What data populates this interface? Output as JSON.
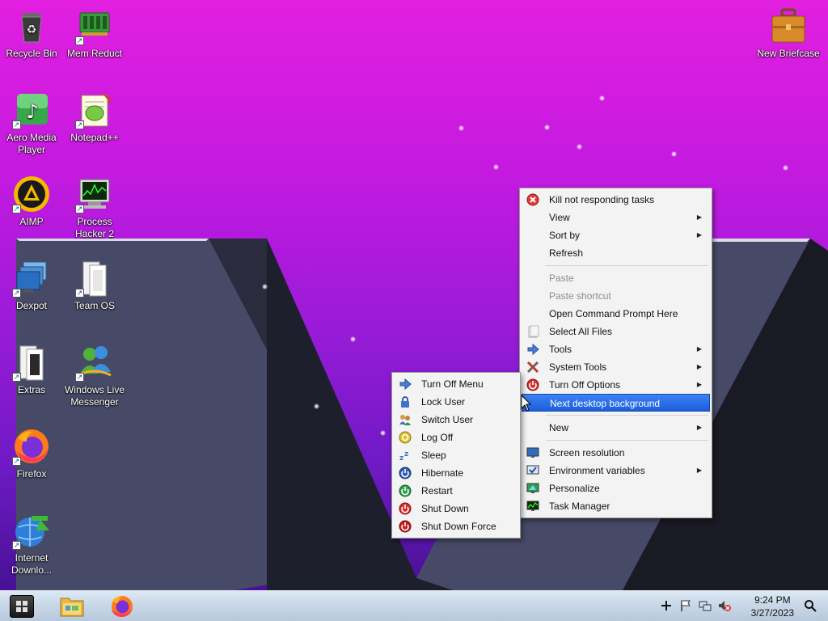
{
  "desktop": {
    "icons": [
      {
        "label": "Recycle Bin",
        "icon": "recycle-bin-icon"
      },
      {
        "label": "Mem Reduct",
        "icon": "mem-reduct-icon"
      },
      {
        "label": "Aero Media Player",
        "icon": "media-player-icon"
      },
      {
        "label": "Notepad++",
        "icon": "notepad-plus-plus-icon"
      },
      {
        "label": "AIMP",
        "icon": "aimp-icon"
      },
      {
        "label": "Process Hacker 2",
        "icon": "process-hacker-icon"
      },
      {
        "label": "Dexpot",
        "icon": "dexpot-icon"
      },
      {
        "label": "Team OS",
        "icon": "folder-icon"
      },
      {
        "label": "Extras",
        "icon": "folder-icon"
      },
      {
        "label": "Windows Live Messenger",
        "icon": "messenger-icon"
      },
      {
        "label": "Firefox",
        "icon": "firefox-icon"
      },
      {
        "label": "Internet Downlo...",
        "icon": "internet-download-manager-icon"
      },
      {
        "label": "New Briefcase",
        "icon": "briefcase-icon"
      }
    ]
  },
  "context_menu": {
    "items": [
      {
        "label": "Kill not responding tasks",
        "icon": "kill-tasks-icon"
      },
      {
        "label": "View",
        "submenu": true
      },
      {
        "label": "Sort by",
        "submenu": true
      },
      {
        "label": "Refresh"
      },
      {
        "label": "Paste",
        "disabled": true
      },
      {
        "label": "Paste shortcut",
        "disabled": true
      },
      {
        "label": "Open Command Prompt Here"
      },
      {
        "label": "Select All Files",
        "icon": "select-all-icon"
      },
      {
        "label": "Tools",
        "icon": "tools-arrow-icon",
        "submenu": true
      },
      {
        "label": "System Tools",
        "icon": "system-tools-icon",
        "submenu": true
      },
      {
        "label": "Turn Off Options",
        "icon": "power-icon",
        "submenu": true
      },
      {
        "label": "Next desktop background",
        "highlighted": true
      },
      {
        "label": "New",
        "submenu": true
      },
      {
        "label": "Screen resolution",
        "icon": "monitor-icon"
      },
      {
        "label": "Environment variables",
        "icon": "monitor-check-icon",
        "submenu": true
      },
      {
        "label": "Personalize",
        "icon": "personalize-icon"
      },
      {
        "label": "Task Manager",
        "icon": "task-manager-icon"
      }
    ]
  },
  "turn_off_submenu": {
    "items": [
      {
        "label": "Turn Off Menu",
        "icon": "arrow-right-icon"
      },
      {
        "label": "Lock User",
        "icon": "lock-icon"
      },
      {
        "label": "Switch User",
        "icon": "switch-user-icon"
      },
      {
        "label": "Log Off",
        "icon": "log-off-icon"
      },
      {
        "label": "Sleep",
        "icon": "sleep-icon"
      },
      {
        "label": "Hibernate",
        "icon": "hibernate-icon"
      },
      {
        "label": "Restart",
        "icon": "restart-icon"
      },
      {
        "label": "Shut Down",
        "icon": "shut-down-icon"
      },
      {
        "label": "Shut Down Force",
        "icon": "shut-down-force-icon"
      }
    ]
  },
  "taskbar": {
    "clock": {
      "time": "9:24 PM",
      "date": "3/27/2023"
    },
    "pinned": [
      "file-explorer-icon",
      "firefox-icon"
    ],
    "tray": [
      "plus-icon",
      "action-center-flag-icon",
      "network-icon",
      "volume-muted-icon",
      "search-icon"
    ]
  },
  "colors": {
    "highlight": "#1c5edb",
    "menu_bg": "#f3f3f3",
    "wallpaper_top": "#e21fe0",
    "wallpaper_bottom": "#3e0e8a"
  }
}
